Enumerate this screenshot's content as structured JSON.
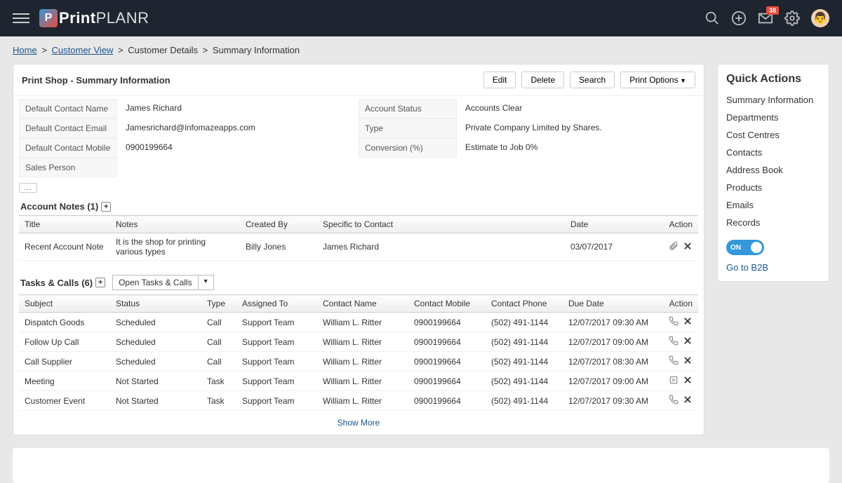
{
  "header": {
    "logo_bold": "Print",
    "logo_light": "PLANR",
    "badge": "38"
  },
  "breadcrumb": {
    "home": "Home",
    "customer_view": "Customer View",
    "customer_details": "Customer Details",
    "summary": "Summary Information"
  },
  "panel": {
    "title": "Print Shop - Summary Information",
    "edit": "Edit",
    "delete": "Delete",
    "search": "Search",
    "print_options": "Print Options"
  },
  "details_left": [
    {
      "label": "Default Contact Name",
      "value": "James Richard"
    },
    {
      "label": "Default Contact Email",
      "value": "Jamesrichard@infomazeapps.com"
    },
    {
      "label": "Default Contact Mobile",
      "value": "0900199664"
    },
    {
      "label": "Sales Person",
      "value": ""
    }
  ],
  "details_right": [
    {
      "label": "Account Status",
      "value": "Accounts Clear"
    },
    {
      "label": "Type",
      "value": "Private Company Limited by Shares."
    },
    {
      "label": "Conversion (%)",
      "value": "Estimate to Job 0%"
    }
  ],
  "more": "...",
  "notes": {
    "title": "Account Notes (1)",
    "headers": {
      "title": "Title",
      "notes": "Notes",
      "created_by": "Created By",
      "specific": "Specific to Contact",
      "date": "Date",
      "action": "Action"
    },
    "rows": [
      {
        "title": "Recent Account Note",
        "notes": "It is the shop for printing various types",
        "created_by": "Billy Jones",
        "specific": "James Richard",
        "date": "03/07/2017"
      }
    ]
  },
  "tasks": {
    "title": "Tasks & Calls (6)",
    "filter": "Open Tasks & Calls",
    "headers": {
      "subject": "Subject",
      "status": "Status",
      "type": "Type",
      "assigned": "Assigned To",
      "contact_name": "Contact Name",
      "contact_mobile": "Contact Mobile",
      "contact_phone": "Contact Phone",
      "due_date": "Due Date",
      "action": "Action"
    },
    "rows": [
      {
        "subject": "Dispatch Goods",
        "status": "Scheduled",
        "type": "Call",
        "assigned": "Support Team",
        "contact_name": "William L. Ritter",
        "contact_mobile": "0900199664",
        "contact_phone": "(502) 491-1144",
        "due_date": "12/07/2017 09:30 AM",
        "icon": "call"
      },
      {
        "subject": "Follow Up Call",
        "status": "Scheduled",
        "type": "Call",
        "assigned": "Support Team",
        "contact_name": "William L. Ritter",
        "contact_mobile": "0900199664",
        "contact_phone": "(502) 491-1144",
        "due_date": "12/07/2017 09:00 AM",
        "icon": "call"
      },
      {
        "subject": "Call Supplier",
        "status": "Scheduled",
        "type": "Call",
        "assigned": "Support Team",
        "contact_name": "William L. Ritter",
        "contact_mobile": "0900199664",
        "contact_phone": "(502) 491-1144",
        "due_date": "12/07/2017 08:30 AM",
        "icon": "call"
      },
      {
        "subject": "Meeting",
        "status": "Not Started",
        "type": "Task",
        "assigned": "Support Team",
        "contact_name": "William L. Ritter",
        "contact_mobile": "0900199664",
        "contact_phone": "(502) 491-1144",
        "due_date": "12/07/2017 09:00 AM",
        "icon": "task"
      },
      {
        "subject": "Customer Event",
        "status": "Not Started",
        "type": "Task",
        "assigned": "Support Team",
        "contact_name": "William L. Ritter",
        "contact_mobile": "0900199664",
        "contact_phone": "(502) 491-1144",
        "due_date": "12/07/2017 09:30 AM",
        "icon": "call"
      }
    ],
    "show_more": "Show More"
  },
  "quick": {
    "title": "Quick Actions",
    "links": [
      "Summary Information",
      "Departments",
      "Cost Centres",
      "Contacts",
      "Address Book",
      "Products",
      "Emails",
      "Records"
    ],
    "toggle": "ON",
    "goto": "Go to B2B"
  }
}
